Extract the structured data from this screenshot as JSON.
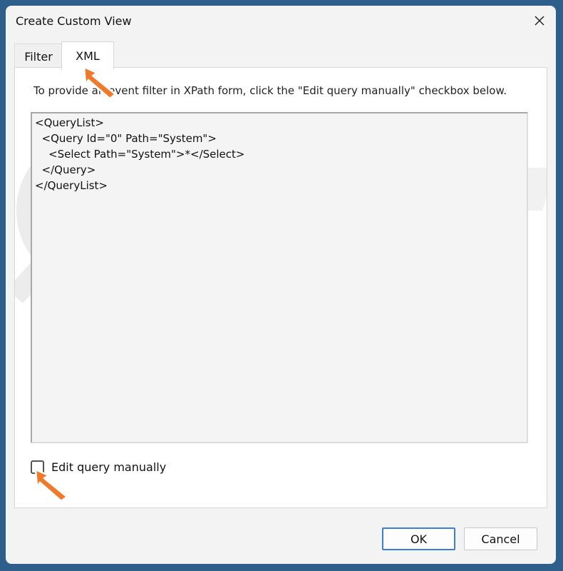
{
  "window": {
    "title": "Create Custom View",
    "close_icon": "close-icon"
  },
  "tabs": [
    {
      "label": "Filter",
      "selected": false
    },
    {
      "label": "XML",
      "selected": true
    }
  ],
  "xml_panel": {
    "instruction": "To provide an event filter in XPath form, click the \"Edit query manually\" checkbox below.",
    "query_lines": [
      "<QueryList>",
      "  <Query Id=\"0\" Path=\"System\">",
      "    <Select Path=\"System\">*</Select>",
      "  </Query>",
      "</QueryList>"
    ],
    "edit_manually": {
      "label": "Edit query manually",
      "checked": false
    }
  },
  "buttons": {
    "ok": "OK",
    "cancel": "Cancel"
  },
  "colors": {
    "accent": "#3b7fd4",
    "arrow": "#f07a2a",
    "background": "#2e5f8a"
  }
}
